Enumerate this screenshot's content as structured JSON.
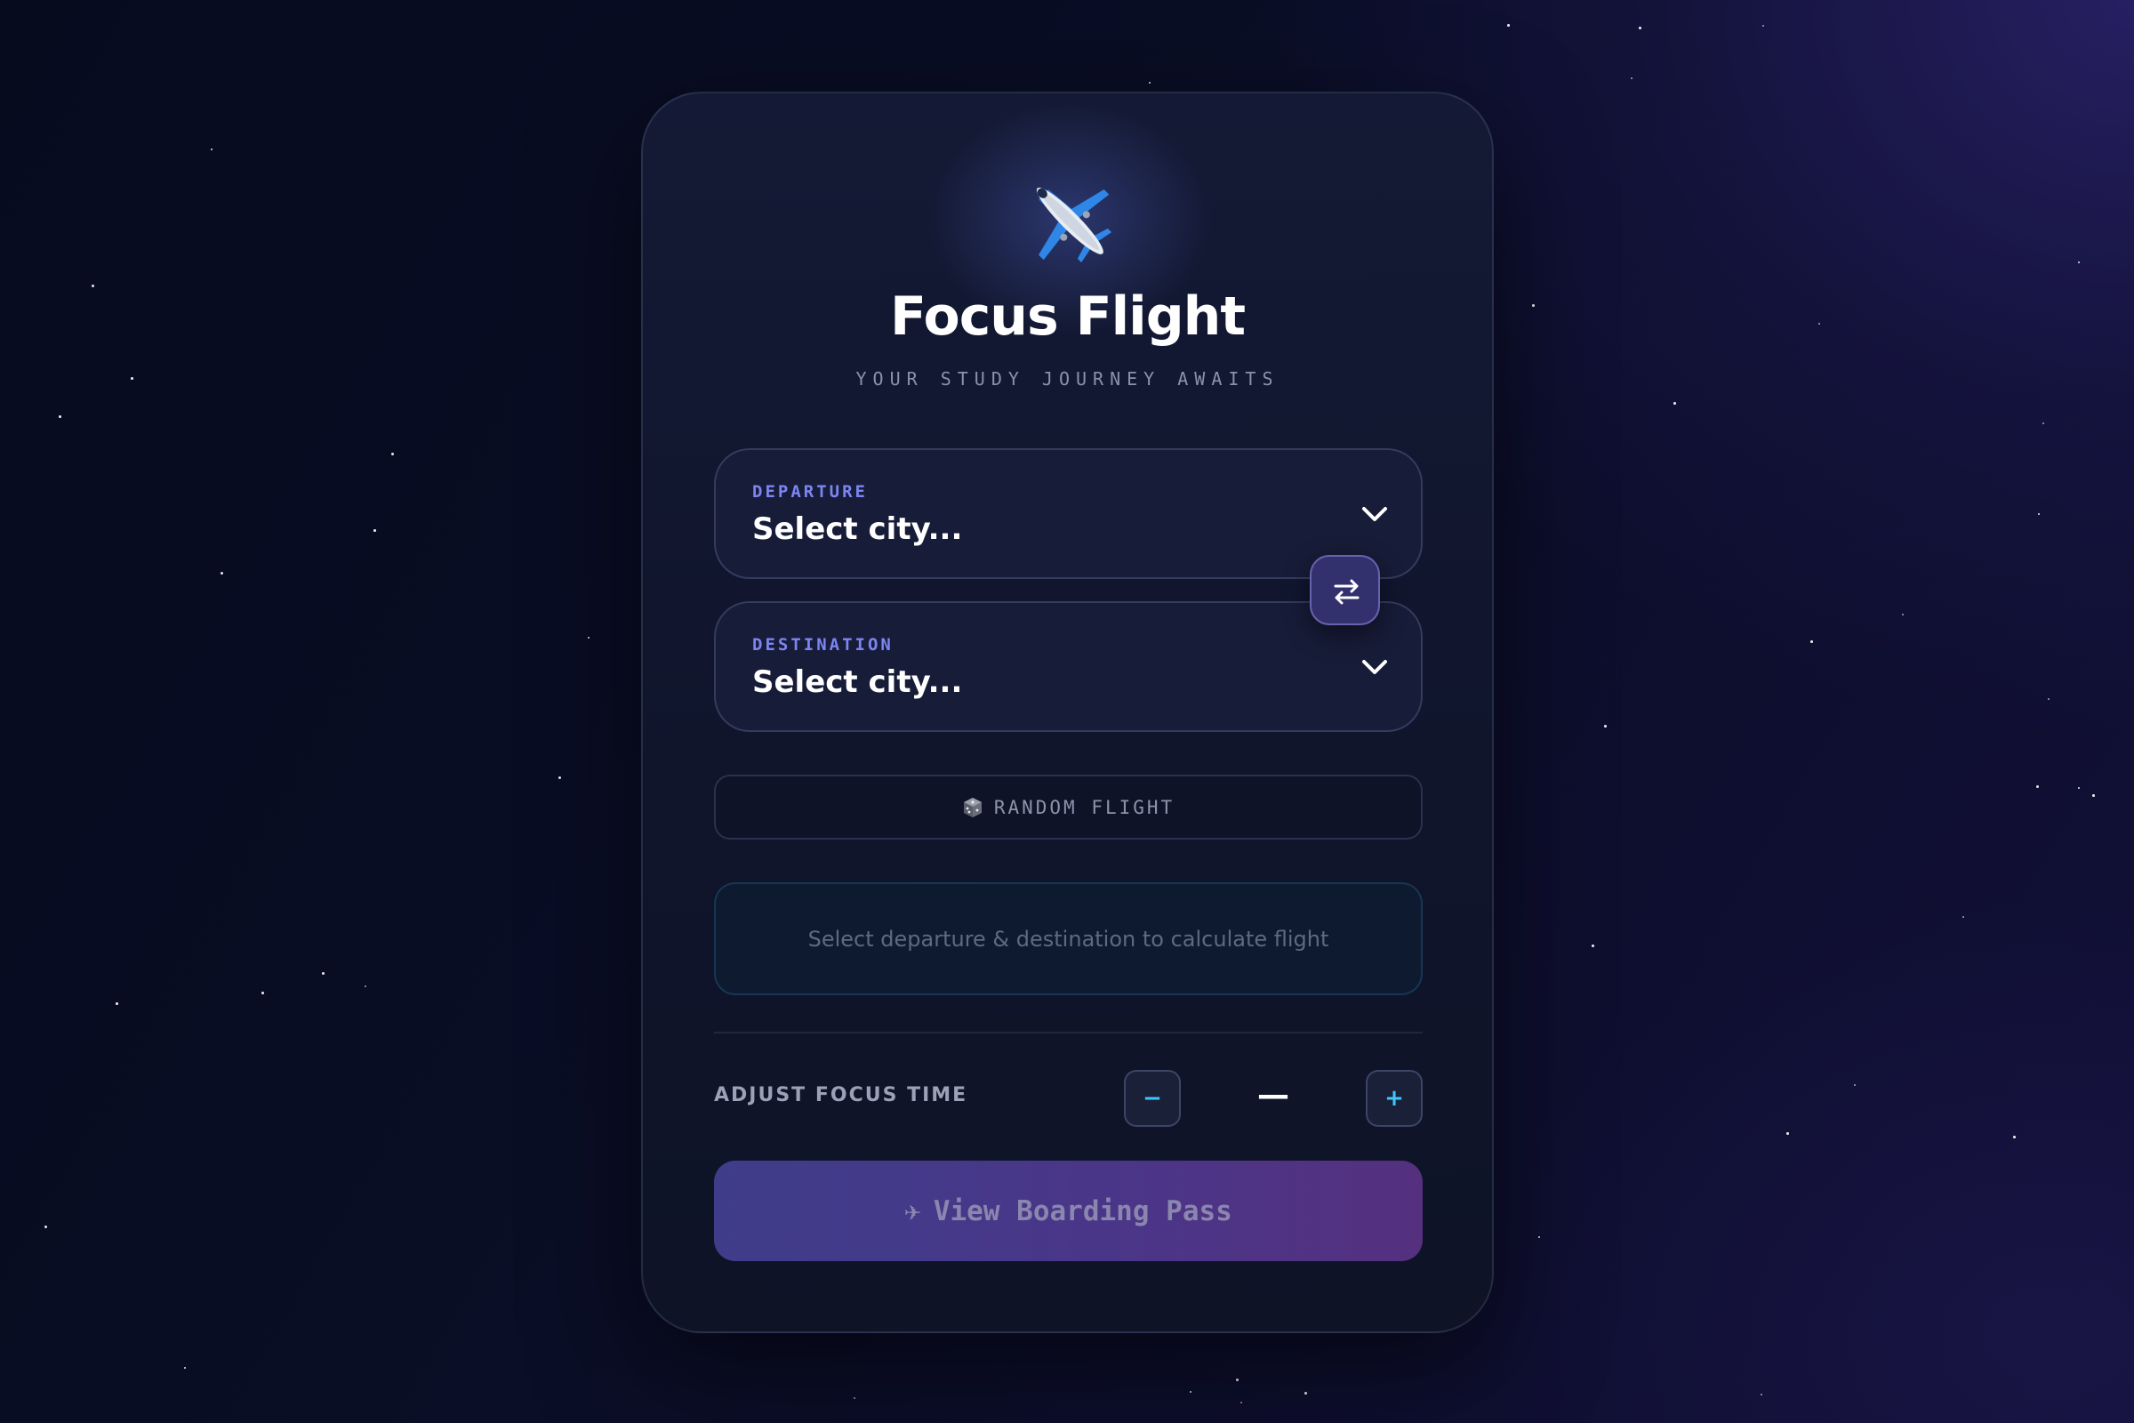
{
  "app": {
    "title": "Focus Flight",
    "subtitle": "YOUR STUDY JOURNEY AWAITS",
    "hero_icon": "airplane-icon"
  },
  "departure": {
    "label": "DEPARTURE",
    "value": "Select city..."
  },
  "destination": {
    "label": "DESTINATION",
    "value": "Select city..."
  },
  "swap_button": {
    "icon": "swap-arrows-icon"
  },
  "random_flight": {
    "icon": "dice-icon",
    "label": "RANDOM FLIGHT"
  },
  "flight_info": {
    "message": "Select departure & destination to calculate flight"
  },
  "focus_time": {
    "label": "ADJUST FOCUS TIME",
    "decrement_label": "−",
    "increment_label": "+",
    "value": "—"
  },
  "boarding_pass": {
    "icon": "✈",
    "label": "View Boarding Pass"
  },
  "colors": {
    "accent_blue": "#7c85f2",
    "accent_cyan": "#3fc6ff",
    "button_gradient_start": "#3f3d8a",
    "button_gradient_end": "#55307f",
    "card_bg": "#10152c"
  }
}
